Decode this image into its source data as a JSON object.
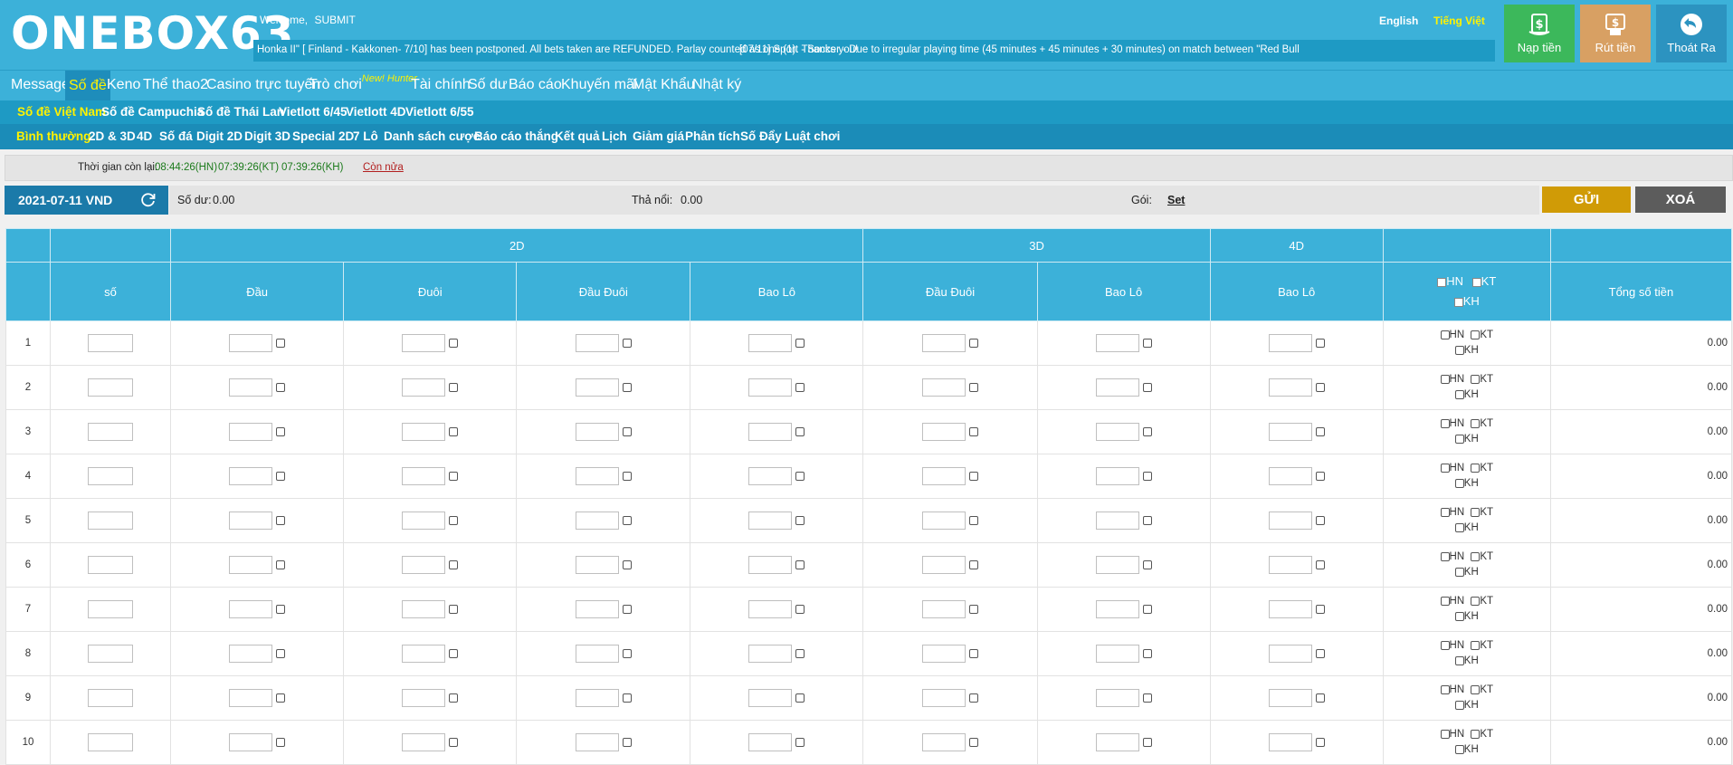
{
  "header": {
    "logo": "ONEBOX63",
    "welcome_label": "Welcome,",
    "username": "SUBMIT",
    "ticker_1": "Honka II\" [ Finland - Kakkonen- 7/10] has been postponed. All bets taken are REFUNDED. Parlay counted as one (1). Thanks you!",
    "ticker_2": "[07/11] Sport - Soccer - Due to irregular playing time (45 minutes + 45 minutes + 30 minutes) on match between \"Red Bull",
    "lang_en": "English",
    "lang_vi": "Tiếng Việt",
    "deposit_label": "Nạp tiền",
    "withdraw_label": "Rút tiền",
    "logout_label": "Thoát Ra",
    "deposit_color": "#3cb85b",
    "withdraw_color": "#d8a063",
    "logout_color": "#2c93c0"
  },
  "main_nav": {
    "items": [
      "Message",
      "Số đề",
      "Keno",
      "Thể thao2",
      "Casino trực tuyến",
      "Trò chơi",
      "Tài chính",
      "Số dư",
      "Báo cáo",
      "Khuyến mãi",
      "Mật Khẩu",
      "Nhật ký"
    ],
    "new_tag": "New! Hunter",
    "active": "Số đề"
  },
  "sub_nav_1": {
    "items": [
      "Số đề Việt Nam",
      "Số đề Campuchia",
      "Số đề Thái Lan",
      "Vietlott 6/45",
      "Vietlott 4D",
      "Vietlott 6/55"
    ],
    "active": "Số đề Việt Nam"
  },
  "sub_nav_2": {
    "items": [
      "Bình thường",
      "2D & 3D",
      "4D",
      "Số đá",
      "Digit 2D",
      "Digit 3D",
      "Special 2D",
      "7 Lô",
      "Danh sách cược",
      "Báo cáo thắng",
      "Kết quả",
      "Lịch",
      "Giảm giá",
      "Phân tích",
      "Số Đẩy",
      "Luật chơi"
    ],
    "active": "Bình thường"
  },
  "timer": {
    "label": "Thời gian còn lại:",
    "hn": "08:44:26(HN)",
    "kt": "07:39:26(KT)",
    "kh": "07:39:26(KH)",
    "more": "Còn nửa"
  },
  "info": {
    "date": "2021-07-11 VND",
    "balance_label": "Số dư:",
    "balance_value": "0.00",
    "float_label": "Thả nổi:",
    "float_value": "0.00",
    "package_label": "Gói:",
    "package_link": "Set",
    "send_label": "GỬI",
    "clear_label": "XOÁ",
    "send_color": "#d09b06",
    "clear_color": "#5c5c5c"
  },
  "table": {
    "group_headers": [
      "2D",
      "3D",
      "4D"
    ],
    "col_headers": {
      "number": "số",
      "dau": "Đầu",
      "duoi": "Đuôi",
      "dau_duoi_2d": "Đầu Đuôi",
      "bao_lo_2d": "Bao Lô",
      "dau_duoi_3d": "Đầu Đuôi",
      "bao_lo_3d": "Bao Lô",
      "bao_lo_4d": "Bao Lô",
      "region_hn": "HN",
      "region_kt": "KT",
      "region_kh": "KH",
      "total": "Tổng số tiền"
    },
    "rows": [
      {
        "index": "1",
        "total": "0.00"
      },
      {
        "index": "2",
        "total": "0.00"
      },
      {
        "index": "3",
        "total": "0.00"
      },
      {
        "index": "4",
        "total": "0.00"
      },
      {
        "index": "5",
        "total": "0.00"
      },
      {
        "index": "6",
        "total": "0.00"
      },
      {
        "index": "7",
        "total": "0.00"
      },
      {
        "index": "8",
        "total": "0.00"
      },
      {
        "index": "9",
        "total": "0.00"
      },
      {
        "index": "10",
        "total": "0.00"
      }
    ]
  }
}
